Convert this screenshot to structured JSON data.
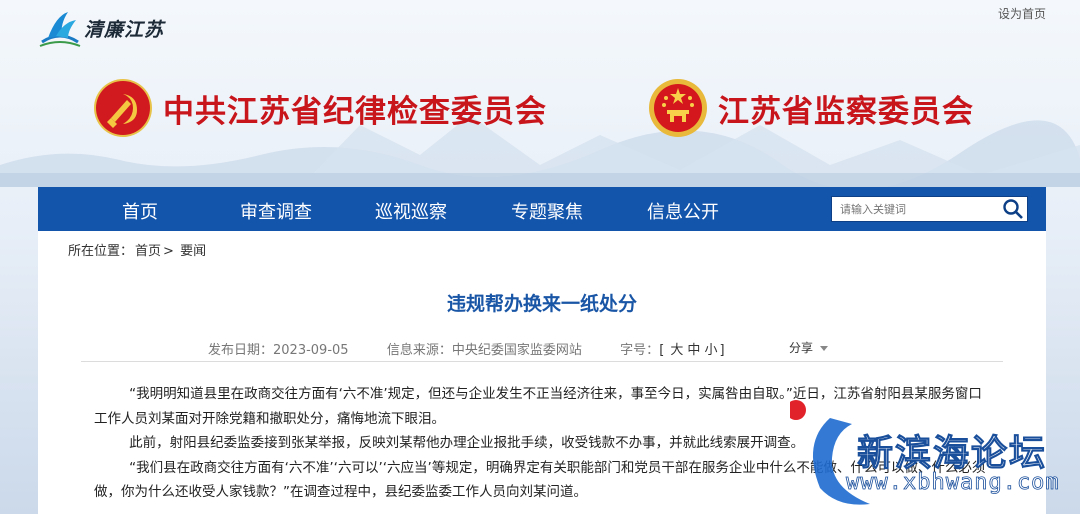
{
  "header": {
    "logo_text": "清廉江苏",
    "set_homepage": "设为首页",
    "title_left": "中共江苏省纪律检查委员会",
    "title_right": "江苏省监察委员会"
  },
  "nav": {
    "items": [
      "首页",
      "审查调查",
      "巡视巡察",
      "专题聚焦",
      "信息公开"
    ],
    "search_placeholder": "请输入关键词"
  },
  "breadcrumb": {
    "prefix": "所在位置：",
    "home": "首页",
    "sep": ">",
    "current": "要闻"
  },
  "article": {
    "title": "违规帮办换来一纸处分",
    "date_label": "发布日期：",
    "date": "2023-09-05",
    "source_label": "信息来源：",
    "source": "中央纪委国家监委网站",
    "fontsize_label": "字号：",
    "fontsize_large": "大",
    "fontsize_medium": "中",
    "fontsize_small": "小",
    "share": "分享",
    "paragraphs": [
      "“我明明知道县里在政商交往方面有‘六不准’规定，但还与企业发生不正当经济往来，事至今日，实属咎由自取。”近日，江苏省射阳县某服务窗口工作人员刘某面对开除党籍和撤职处分，痛悔地流下眼泪。",
      "此前，射阳县纪委监委接到张某举报，反映刘某帮他办理企业报批手续，收受钱款不办事，并就此线索展开调查。",
      "“我们县在政商交往方面有‘六不准’‘六可以’‘六应当’等规定，明确界定有关职能部门和党员干部在服务企业中什么不能做、什么可以做、什么必须做，你为什么还收受人家钱款？”在调查过程中，县纪委监委工作人员向刘某问道。"
    ]
  },
  "watermark": {
    "title": "新滨海论坛",
    "url": "www.xbhwang.com"
  },
  "colors": {
    "nav_blue": "#1455ac",
    "title_red": "#c8151b",
    "article_title_blue": "#1a56a6"
  }
}
